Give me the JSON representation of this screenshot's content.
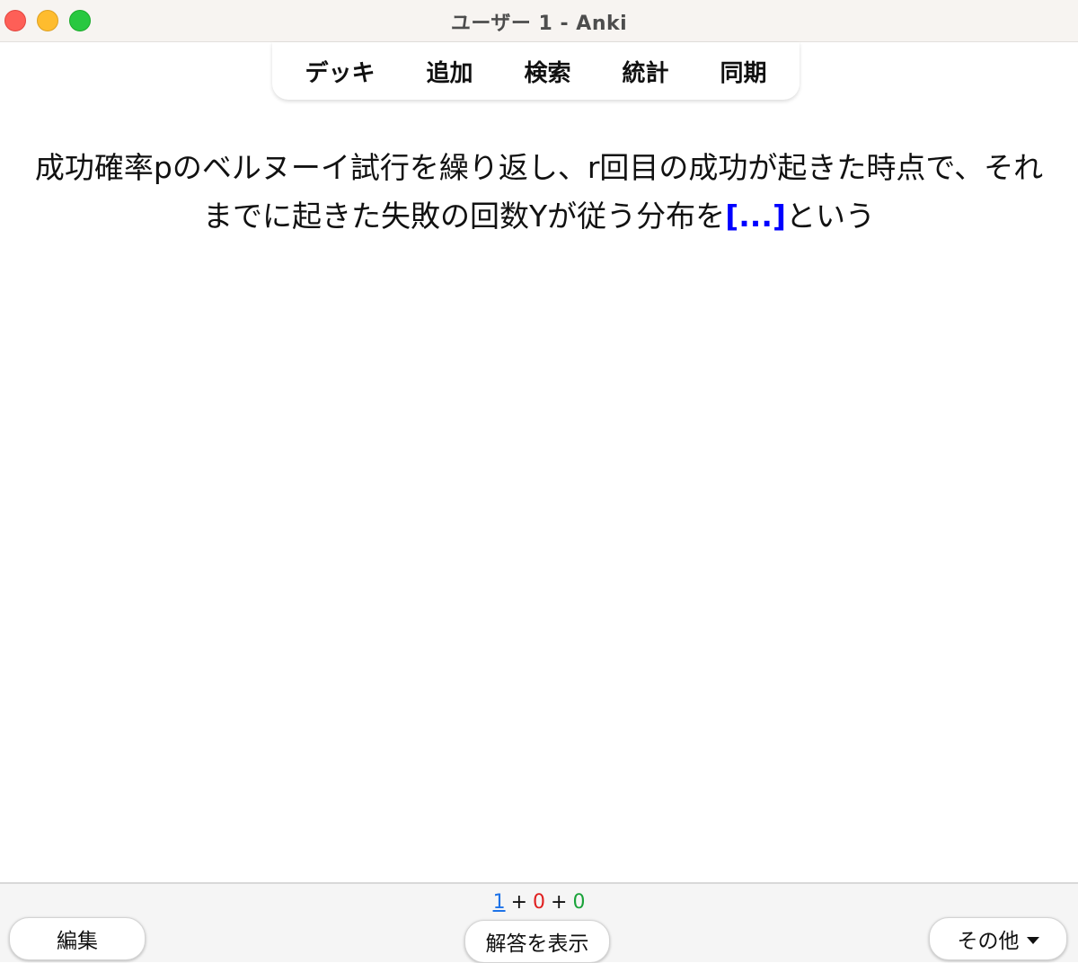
{
  "window": {
    "title": "ユーザー 1 - Anki"
  },
  "toolbar": {
    "decks": "デッキ",
    "add": "追加",
    "browse": "検索",
    "stats": "統計",
    "sync": "同期"
  },
  "card": {
    "question_before": "成功確率pのベルヌーイ試行を繰り返し、r回目の成功が起きた時点で、それまでに起きた失敗の回数Yが従う分布を",
    "cloze": "[...]",
    "question_after": "という"
  },
  "counts": {
    "new": "1",
    "learning": "0",
    "review": "0",
    "separator": "+"
  },
  "bottom": {
    "edit_label": "編集",
    "show_answer_label": "解答を表示",
    "more_label": "その他"
  },
  "colors": {
    "cloze": "#0000ff",
    "new": "#1e73e8",
    "learning": "#e02020",
    "review": "#1aa33a"
  }
}
